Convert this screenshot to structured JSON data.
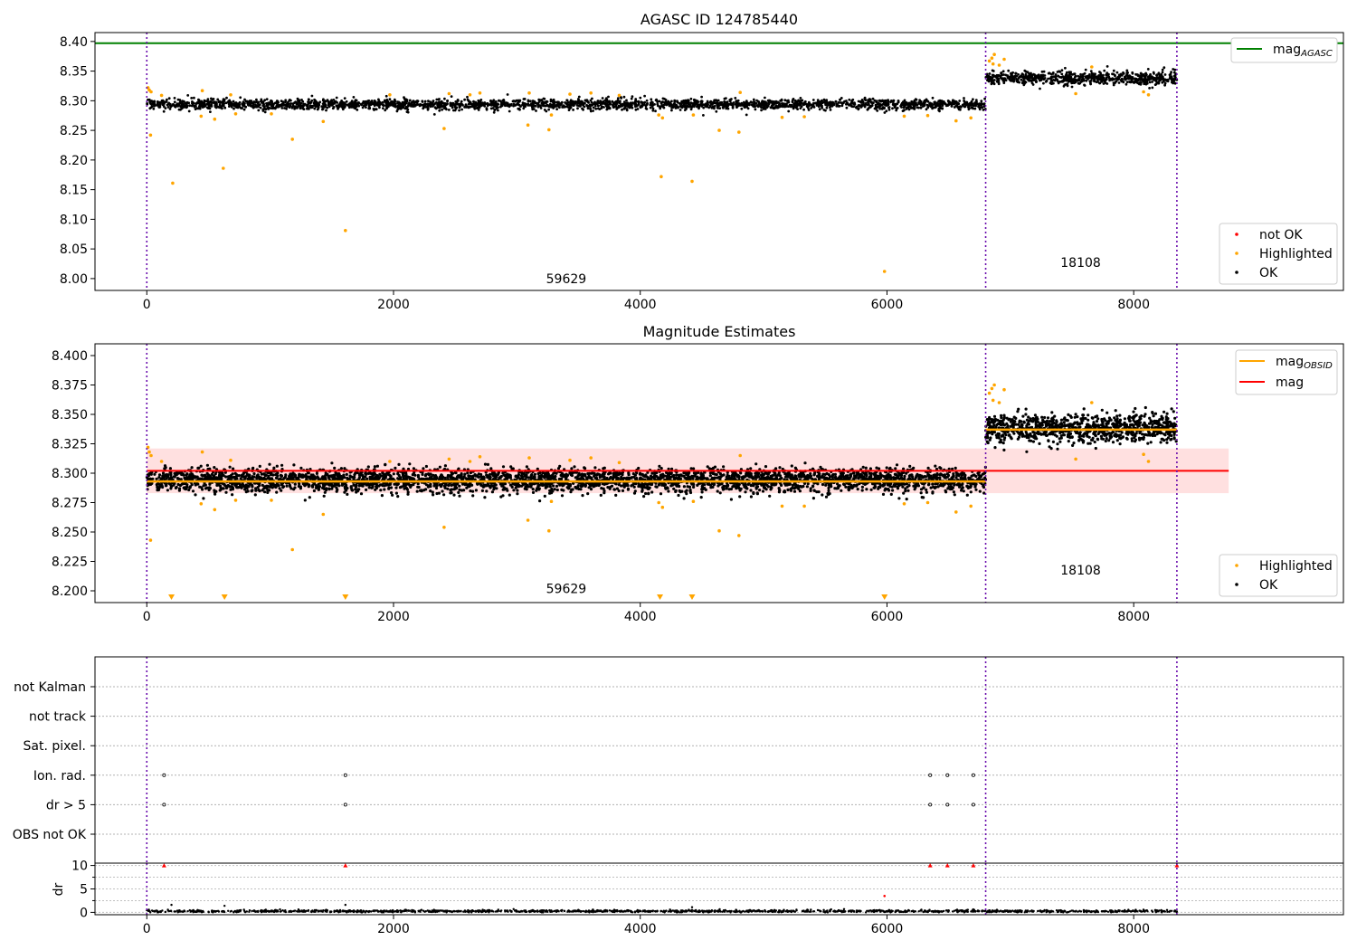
{
  "chart_data": [
    {
      "type": "scatter",
      "title": "AGASC ID 124785440",
      "xlim": [
        -420,
        9700
      ],
      "ylim": [
        7.98,
        8.415
      ],
      "x_ticks": [
        0,
        2000,
        4000,
        6000,
        8000
      ],
      "x_tick_labels": [
        "0",
        "2000",
        "4000",
        "6000",
        "8000"
      ],
      "y_ticks": [
        8.0,
        8.05,
        8.1,
        8.15,
        8.2,
        8.25,
        8.3,
        8.35,
        8.4
      ],
      "y_tick_labels": [
        "8.00",
        "8.05",
        "8.10",
        "8.15",
        "8.20",
        "8.25",
        "8.30",
        "8.35",
        "8.40"
      ],
      "obs_boundaries": [
        0,
        6800,
        8350
      ],
      "obs_annotations": [
        {
          "x": 3400,
          "y": 7.992,
          "text": "59629"
        },
        {
          "x": 7570,
          "y": 8.02,
          "text": "18108"
        }
      ],
      "mag_agasc": 8.397,
      "mag_agasc_color": "#008000",
      "series_bands": [
        {
          "name": "OK",
          "x_start": 0,
          "x_end": 6800,
          "center": 8.294,
          "spread": 0.008,
          "color": "#000000"
        },
        {
          "name": "OK",
          "x_start": 6800,
          "x_end": 8350,
          "center": 8.338,
          "spread": 0.01,
          "color": "#000000"
        }
      ],
      "highlighted_points": [
        [
          10,
          8.322
        ],
        [
          20,
          8.318
        ],
        [
          35,
          8.315
        ],
        [
          30,
          8.242
        ],
        [
          120,
          8.309
        ],
        [
          210,
          8.161
        ],
        [
          440,
          8.274
        ],
        [
          450,
          8.317
        ],
        [
          550,
          8.269
        ],
        [
          620,
          8.186
        ],
        [
          680,
          8.31
        ],
        [
          720,
          8.278
        ],
        [
          1010,
          8.278
        ],
        [
          1180,
          8.235
        ],
        [
          1430,
          8.265
        ],
        [
          1610,
          8.081
        ],
        [
          1970,
          8.31
        ],
        [
          2410,
          8.253
        ],
        [
          2450,
          8.312
        ],
        [
          2620,
          8.31
        ],
        [
          2700,
          8.313
        ],
        [
          3090,
          8.259
        ],
        [
          3100,
          8.313
        ],
        [
          3260,
          8.251
        ],
        [
          3280,
          8.276
        ],
        [
          3430,
          8.311
        ],
        [
          3600,
          8.313
        ],
        [
          3830,
          8.309
        ],
        [
          4150,
          8.276
        ],
        [
          4170,
          8.172
        ],
        [
          4180,
          8.271
        ],
        [
          4420,
          8.164
        ],
        [
          4430,
          8.276
        ],
        [
          4640,
          8.25
        ],
        [
          4800,
          8.247
        ],
        [
          4810,
          8.314
        ],
        [
          5150,
          8.272
        ],
        [
          5330,
          8.273
        ],
        [
          5980,
          8.012
        ],
        [
          6140,
          8.274
        ],
        [
          6330,
          8.275
        ],
        [
          6560,
          8.266
        ],
        [
          6680,
          8.271
        ],
        [
          6830,
          8.367
        ],
        [
          6850,
          8.372
        ],
        [
          6860,
          8.362
        ],
        [
          6870,
          8.378
        ],
        [
          6910,
          8.36
        ],
        [
          6950,
          8.37
        ],
        [
          7530,
          8.312
        ],
        [
          7660,
          8.357
        ],
        [
          8080,
          8.315
        ],
        [
          8120,
          8.31
        ]
      ],
      "highlighted_color": "#FFA500",
      "not_ok_color": "#FF0000",
      "ok_color": "#000000",
      "legend_lines": [
        {
          "name": "mag",
          "subscript": "AGASC",
          "color": "#008000"
        }
      ],
      "legend_markers": [
        {
          "name": "not OK",
          "color": "#FF0000"
        },
        {
          "name": "Highlighted",
          "color": "#FFA500"
        },
        {
          "name": "OK",
          "color": "#000000"
        }
      ],
      "legend_lines_position": "top-right",
      "legend_markers_position": "lower-right"
    },
    {
      "type": "scatter",
      "title": "Magnitude Estimates",
      "xlim": [
        -420,
        9700
      ],
      "ylim": [
        8.19,
        8.41
      ],
      "x_ticks": [
        0,
        2000,
        4000,
        6000,
        8000
      ],
      "x_tick_labels": [
        "0",
        "2000",
        "4000",
        "6000",
        "8000"
      ],
      "y_ticks": [
        8.2,
        8.225,
        8.25,
        8.275,
        8.3,
        8.325,
        8.35,
        8.375,
        8.4
      ],
      "y_tick_labels": [
        "8.200",
        "8.225",
        "8.250",
        "8.275",
        "8.300",
        "8.325",
        "8.350",
        "8.375",
        "8.400"
      ],
      "obs_boundaries": [
        0,
        6800,
        8350
      ],
      "obs_annotations": [
        {
          "x": 3400,
          "y": 8.198,
          "text": "59629"
        },
        {
          "x": 7570,
          "y": 8.214,
          "text": "18108"
        }
      ],
      "mag": 8.302,
      "mag_band": [
        8.283,
        8.321
      ],
      "mag_band_x": [
        0,
        8770
      ],
      "mag_color": "#FF0000",
      "mag_obsid_segments": [
        {
          "x_start": 0,
          "x_end": 6800,
          "value": 8.293
        },
        {
          "x_start": 6800,
          "x_end": 8350,
          "value": 8.337
        }
      ],
      "mag_obsid_color": "#FFA500",
      "series_bands": [
        {
          "name": "OK",
          "x_start": 0,
          "x_end": 6800,
          "center": 8.294,
          "spread": 0.009,
          "color": "#000000"
        },
        {
          "name": "OK",
          "x_start": 6800,
          "x_end": 8350,
          "center": 8.338,
          "spread": 0.011,
          "color": "#000000"
        }
      ],
      "highlighted_points": [
        [
          10,
          8.322
        ],
        [
          20,
          8.318
        ],
        [
          35,
          8.315
        ],
        [
          30,
          8.243
        ],
        [
          120,
          8.31
        ],
        [
          440,
          8.274
        ],
        [
          450,
          8.318
        ],
        [
          550,
          8.269
        ],
        [
          680,
          8.311
        ],
        [
          720,
          8.277
        ],
        [
          1010,
          8.277
        ],
        [
          1180,
          8.235
        ],
        [
          1430,
          8.265
        ],
        [
          1970,
          8.31
        ],
        [
          2410,
          8.254
        ],
        [
          2450,
          8.312
        ],
        [
          2620,
          8.31
        ],
        [
          2700,
          8.314
        ],
        [
          3090,
          8.26
        ],
        [
          3100,
          8.313
        ],
        [
          3260,
          8.251
        ],
        [
          3280,
          8.276
        ],
        [
          3430,
          8.311
        ],
        [
          3600,
          8.313
        ],
        [
          3830,
          8.309
        ],
        [
          4150,
          8.275
        ],
        [
          4180,
          8.271
        ],
        [
          4430,
          8.276
        ],
        [
          4640,
          8.251
        ],
        [
          4800,
          8.247
        ],
        [
          4810,
          8.315
        ],
        [
          5150,
          8.272
        ],
        [
          5330,
          8.272
        ],
        [
          6140,
          8.274
        ],
        [
          6330,
          8.275
        ],
        [
          6560,
          8.267
        ],
        [
          6680,
          8.272
        ],
        [
          6830,
          8.368
        ],
        [
          6850,
          8.372
        ],
        [
          6860,
          8.362
        ],
        [
          6870,
          8.375
        ],
        [
          6910,
          8.36
        ],
        [
          6950,
          8.371
        ],
        [
          7530,
          8.312
        ],
        [
          7660,
          8.36
        ],
        [
          8080,
          8.316
        ],
        [
          8120,
          8.31
        ]
      ],
      "below_range_x": [
        200,
        630,
        1610,
        4160,
        4420,
        5980
      ],
      "highlighted_color": "#FFA500",
      "ok_color": "#000000",
      "legend_lines": [
        {
          "name": "mag",
          "subscript": "OBSID",
          "color": "#FFA500"
        },
        {
          "name": "mag",
          "subscript": "",
          "color": "#FF0000"
        }
      ],
      "legend_markers": [
        {
          "name": "Highlighted",
          "color": "#FFA500"
        },
        {
          "name": "OK",
          "color": "#000000"
        }
      ],
      "legend_lines_position": "top-right",
      "legend_markers_position": "lower-right"
    },
    {
      "type": "scatter",
      "xlim": [
        -420,
        9700
      ],
      "categories": [
        "not Kalman",
        "not track",
        "Sat. pixel.",
        "Ion. rad.",
        "dr > 5",
        "OBS not OK"
      ],
      "flag_points": [
        {
          "category": "Ion. rad.",
          "x": [
            140,
            1610,
            6350,
            6490,
            6700
          ]
        },
        {
          "category": "dr > 5",
          "x": [
            140,
            1610,
            6350,
            6490,
            6700
          ]
        }
      ],
      "obs_boundaries": [
        0,
        6800,
        8350
      ]
    },
    {
      "type": "scatter",
      "xlim": [
        -420,
        9700
      ],
      "ylim": [
        -0.5,
        10.5
      ],
      "ylabel": "dr",
      "x_ticks": [
        0,
        2000,
        4000,
        6000,
        8000
      ],
      "x_tick_labels": [
        "0",
        "2000",
        "4000",
        "6000",
        "8000"
      ],
      "y_ticks": [
        0,
        5,
        10
      ],
      "y_tick_labels": [
        "0",
        "5",
        "10"
      ],
      "baseline": {
        "x_start": 0,
        "x_end": 8350,
        "center": 0.25,
        "spread": 0.12
      },
      "ok_points": [
        [
          200,
          1.6
        ],
        [
          630,
          1.4
        ],
        [
          1610,
          1.6
        ],
        [
          4420,
          1.1
        ]
      ],
      "capped_points": [
        [
          140,
          10
        ],
        [
          1610,
          10
        ],
        [
          6350,
          10
        ],
        [
          6490,
          10
        ],
        [
          6700,
          10
        ],
        [
          8350,
          10
        ]
      ],
      "not_ok_points": [
        [
          5980,
          3.5
        ]
      ],
      "capped_color": "#FF0000",
      "obs_boundaries": [
        0,
        6800,
        8350
      ]
    }
  ]
}
